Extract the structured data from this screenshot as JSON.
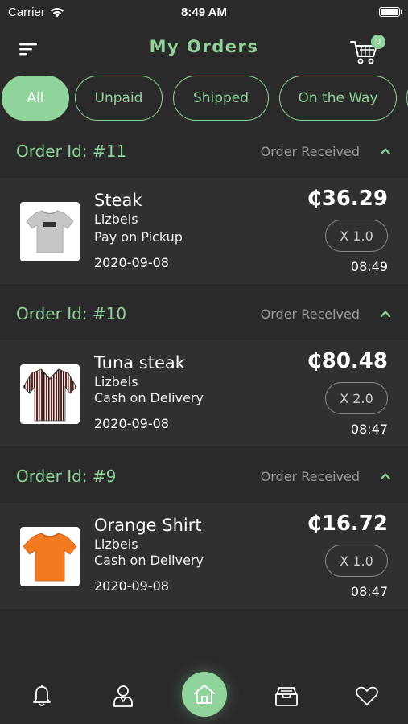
{
  "status_bar": {
    "carrier": "Carrier",
    "time": "8:49 AM"
  },
  "header": {
    "title": "My Orders",
    "cart_count": "0"
  },
  "tabs": [
    {
      "label": "All",
      "active": true
    },
    {
      "label": "Unpaid",
      "active": false
    },
    {
      "label": "Shipped",
      "active": false
    },
    {
      "label": "On the Way",
      "active": false
    }
  ],
  "orders": [
    {
      "id_label": "Order Id: #11",
      "status": "Order Received",
      "item": {
        "name": "Steak",
        "seller": "Lizbels",
        "payment": "Pay on Pickup",
        "date": "2020-09-08",
        "price": "₵36.29",
        "qty": "X 1.0",
        "time": "08:49",
        "image": "grey-vans-tshirt"
      }
    },
    {
      "id_label": "Order Id: #10",
      "status": "Order Received",
      "item": {
        "name": "Tuna steak",
        "seller": "Lizbels",
        "payment": "Cash on Delivery",
        "date": "2020-09-08",
        "price": "₵80.48",
        "qty": "X 2.0",
        "time": "08:47",
        "image": "striped-shirt"
      }
    },
    {
      "id_label": "Order Id: #9",
      "status": "Order Received",
      "item": {
        "name": "Orange Shirt",
        "seller": "Lizbels",
        "payment": "Cash on Delivery",
        "date": "2020-09-08",
        "price": "₵16.72",
        "qty": "X 1.0",
        "time": "08:47",
        "image": "orange-tshirt"
      }
    }
  ],
  "bottom_nav": [
    {
      "icon": "bell-icon"
    },
    {
      "icon": "user-icon"
    },
    {
      "icon": "home-icon",
      "active": true
    },
    {
      "icon": "archive-icon"
    },
    {
      "icon": "heart-icon"
    }
  ],
  "colors": {
    "accent": "#8fd49a",
    "background": "#2a2a2a",
    "card": "#303030"
  }
}
